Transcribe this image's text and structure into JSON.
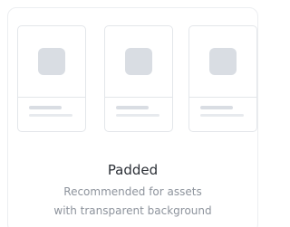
{
  "option": {
    "title": "Padded",
    "description_line1": "Recommended for assets",
    "description_line2": "with transparent background"
  },
  "colors": {
    "card_border": "#eceef1",
    "mini_card_border": "#e3e6ea",
    "placeholder": "#d9dde3",
    "title_text": "#2b2f36",
    "description_text": "#8d939c"
  },
  "preview": {
    "mini_card_count": 3,
    "icon": "image-placeholder-icon"
  }
}
